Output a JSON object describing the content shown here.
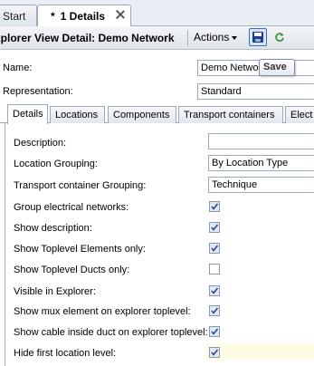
{
  "tabs": [
    {
      "label": "Start"
    },
    {
      "label": "1 Details",
      "prefix": "*"
    }
  ],
  "titlebar": {
    "title": "xplorer View Detail: Demo Network",
    "actions_label": "Actions",
    "save_tooltip": "Save"
  },
  "header_fields": {
    "name_label": "Name:",
    "name_value": "Demo Networ",
    "representation_label": "Representation:",
    "representation_value": "Standard"
  },
  "inner_tabs": [
    "Details",
    "Locations",
    "Components",
    "Transport containers",
    "Elect"
  ],
  "form": {
    "description_label": "Description:",
    "description_value": "",
    "location_grouping_label": "Location Grouping:",
    "location_grouping_value": "By Location Type",
    "transport_grouping_label": "Transport container Grouping:",
    "transport_grouping_value": "Technique",
    "checkboxes": [
      {
        "label": "Group electrical networks:",
        "checked": true
      },
      {
        "label": "Show description:",
        "checked": true
      },
      {
        "label": "Show Toplevel Elements only:",
        "checked": true
      },
      {
        "label": "Show Toplevel Ducts only:",
        "checked": false
      },
      {
        "label": "Visible in Explorer:",
        "checked": true
      },
      {
        "label": "Show mux element on explorer toplevel:",
        "checked": true
      },
      {
        "label": "Show cable inside duct on explorer toplevel:",
        "checked": true
      },
      {
        "label": "Hide first location level:",
        "checked": true
      }
    ]
  },
  "colors": {
    "tab_border": "#9aa8bc",
    "save_icon": "#1b3f8c",
    "refresh_icon": "#3a9a3a",
    "highlight_row": "#fdfde6"
  }
}
